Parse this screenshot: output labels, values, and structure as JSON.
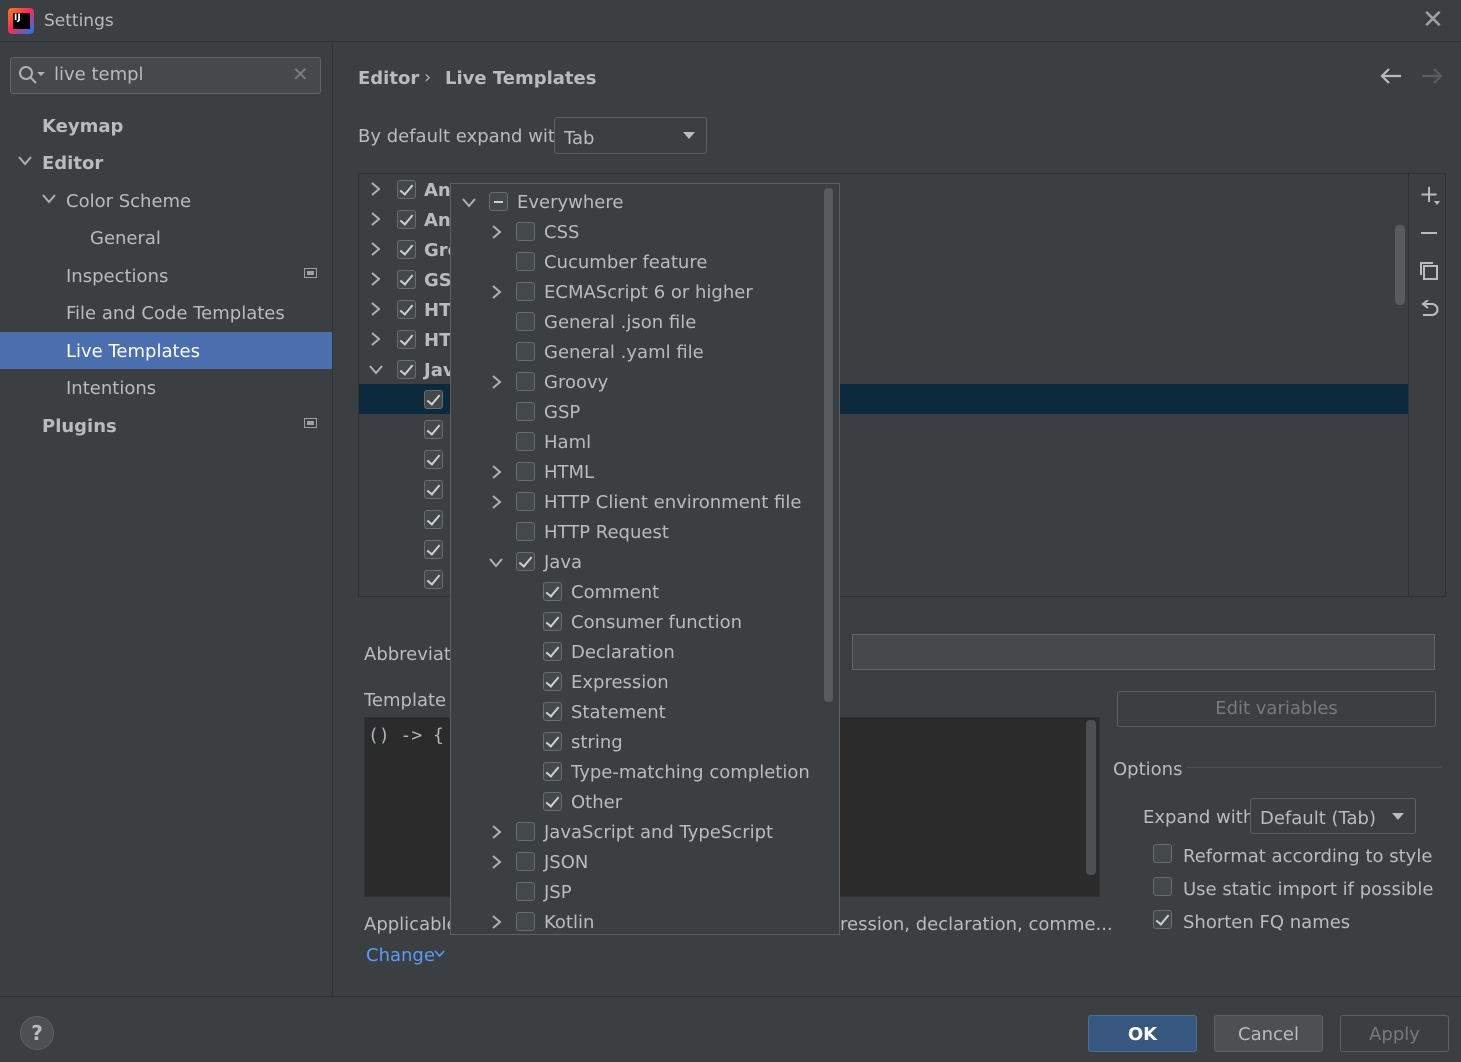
{
  "window": {
    "title": "Settings",
    "close_icon": "close-icon"
  },
  "search": {
    "value": "live templ"
  },
  "sidebar": {
    "items": [
      {
        "label": "Keymap"
      },
      {
        "label": "Editor"
      },
      {
        "label": "Color Scheme"
      },
      {
        "label": "General"
      },
      {
        "label": "Inspections"
      },
      {
        "label": "File and Code Templates"
      },
      {
        "label": "Live Templates",
        "selected": true
      },
      {
        "label": "Intentions"
      },
      {
        "label": "Plugins"
      }
    ]
  },
  "breadcrumb": {
    "parent": "Editor",
    "separator": "›",
    "current": "Live Templates"
  },
  "expand_default": {
    "label": "By default expand with",
    "value": "Tab"
  },
  "tree": {
    "groups": [
      "An",
      "An",
      "Gro",
      "GSI",
      "HT",
      "HT",
      "Jav"
    ]
  },
  "abbreviation": {
    "label": "Abbreviatio"
  },
  "template": {
    "label": "Template t",
    "code": "() -> {"
  },
  "edit_variables": {
    "label": "Edit variables"
  },
  "options": {
    "title": "Options",
    "expand_with_label": "Expand with",
    "expand_with_value": "Default (Tab)",
    "checks": [
      {
        "label": "Reformat according to style",
        "checked": false
      },
      {
        "label": "Use static import if possible",
        "checked": false
      },
      {
        "label": "Shorten FQ names",
        "checked": true
      }
    ]
  },
  "applicable": {
    "label": "Applicable",
    "tail": "ression, declaration, comme...",
    "change": "Change"
  },
  "popup": {
    "items": [
      {
        "label": "Everywhere",
        "level": 0,
        "expander": "open",
        "state": "mixed"
      },
      {
        "label": "CSS",
        "level": 1,
        "expander": "closed",
        "state": "off"
      },
      {
        "label": "Cucumber feature",
        "level": 1,
        "expander": "none",
        "state": "off"
      },
      {
        "label": "ECMAScript 6 or higher",
        "level": 1,
        "expander": "closed",
        "state": "off"
      },
      {
        "label": "General .json file",
        "level": 1,
        "expander": "none",
        "state": "off"
      },
      {
        "label": "General .yaml file",
        "level": 1,
        "expander": "none",
        "state": "off"
      },
      {
        "label": "Groovy",
        "level": 1,
        "expander": "closed",
        "state": "off"
      },
      {
        "label": "GSP",
        "level": 1,
        "expander": "none",
        "state": "off"
      },
      {
        "label": "Haml",
        "level": 1,
        "expander": "none",
        "state": "off"
      },
      {
        "label": "HTML",
        "level": 1,
        "expander": "closed",
        "state": "off"
      },
      {
        "label": "HTTP Client environment file",
        "level": 1,
        "expander": "closed",
        "state": "off"
      },
      {
        "label": "HTTP Request",
        "level": 1,
        "expander": "none",
        "state": "off"
      },
      {
        "label": "Java",
        "level": 1,
        "expander": "open",
        "state": "on"
      },
      {
        "label": "Comment",
        "level": 2,
        "expander": "none",
        "state": "on"
      },
      {
        "label": "Consumer function",
        "level": 2,
        "expander": "none",
        "state": "on"
      },
      {
        "label": "Declaration",
        "level": 2,
        "expander": "none",
        "state": "on"
      },
      {
        "label": "Expression",
        "level": 2,
        "expander": "none",
        "state": "on"
      },
      {
        "label": "Statement",
        "level": 2,
        "expander": "none",
        "state": "on"
      },
      {
        "label": "string",
        "level": 2,
        "expander": "none",
        "state": "on"
      },
      {
        "label": "Type-matching completion",
        "level": 2,
        "expander": "none",
        "state": "on"
      },
      {
        "label": "Other",
        "level": 2,
        "expander": "none",
        "state": "on"
      },
      {
        "label": "JavaScript and TypeScript",
        "level": 1,
        "expander": "closed",
        "state": "off"
      },
      {
        "label": "JSON",
        "level": 1,
        "expander": "closed",
        "state": "off"
      },
      {
        "label": "JSP",
        "level": 1,
        "expander": "none",
        "state": "off"
      },
      {
        "label": "Kotlin",
        "level": 1,
        "expander": "closed",
        "state": "off"
      }
    ]
  },
  "footer": {
    "help": "?",
    "ok": "OK",
    "cancel": "Cancel",
    "apply": "Apply"
  }
}
